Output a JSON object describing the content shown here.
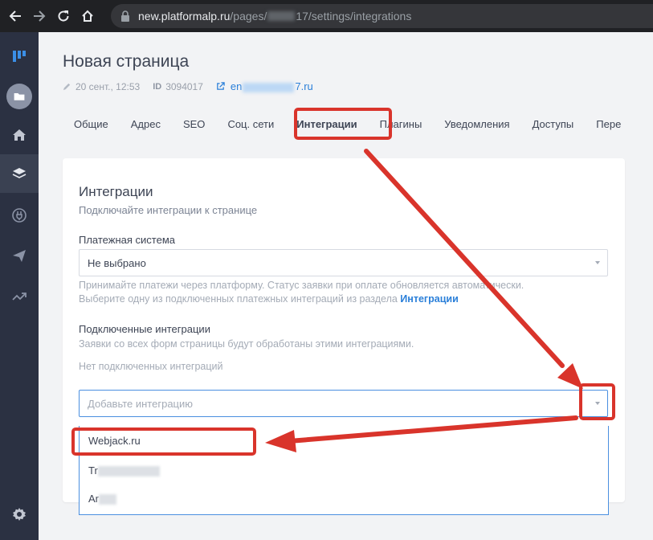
{
  "browser": {
    "url_host": "new.platformalp.ru",
    "url_path_1": "/pages/",
    "url_path_2": "17/settings/integrations"
  },
  "sidebar": {
    "items": [
      {
        "icon": "logo-icon"
      },
      {
        "icon": "folder-icon"
      },
      {
        "icon": "home-icon"
      },
      {
        "icon": "layers-icon"
      },
      {
        "icon": "plug-icon"
      },
      {
        "icon": "send-icon"
      },
      {
        "icon": "chart-icon"
      },
      {
        "icon": "gear-icon"
      }
    ]
  },
  "page": {
    "title": "Новая страница",
    "date": "20 сент., 12:53",
    "id_label": "ID",
    "id_value": "3094017",
    "email_start": "en",
    "email_end": "7.ru"
  },
  "tabs": [
    {
      "label": "Общие"
    },
    {
      "label": "Адрес"
    },
    {
      "label": "SEO"
    },
    {
      "label": "Соц. сети"
    },
    {
      "label": "Интеграции"
    },
    {
      "label": "Плагины"
    },
    {
      "label": "Уведомления"
    },
    {
      "label": "Доступы"
    },
    {
      "label": "Пере"
    }
  ],
  "card": {
    "title": "Интеграции",
    "subtitle": "Подключайте интеграции к странице",
    "payment_label": "Платежная система",
    "payment_value": "Не выбрано",
    "payment_hint_1": "Принимайте платежи через платформу. Статус заявки при оплате обновляется автоматически.",
    "payment_hint_2": "Выберите одну из подключенных платежных интеграций из раздела ",
    "payment_hint_link": "Интеграции",
    "connected_label": "Подключенные интеграции",
    "connected_hint": "Заявки со всех форм страницы будут обработаны этими интеграциями.",
    "no_integrations": "Нет подключенных интеграций",
    "add_placeholder": "Добавьте интеграцию"
  },
  "dropdown": {
    "items": [
      {
        "label": "Webjack.ru"
      },
      {
        "label": "Tr"
      },
      {
        "label": "Ar"
      }
    ]
  },
  "colors": {
    "accent": "#2a7fd9",
    "annotation": "#d9342b",
    "sidebar": "#2b3142"
  }
}
